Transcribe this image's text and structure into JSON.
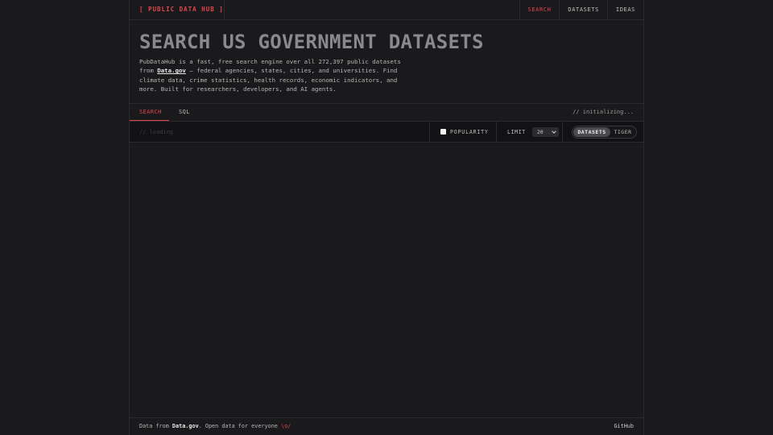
{
  "nav": {
    "brand": "[ PUBLIC DATA HUB ]",
    "links": [
      {
        "label": "SEARCH",
        "active": true
      },
      {
        "label": "DATASETS",
        "active": false
      },
      {
        "label": "IDEAS",
        "active": false
      }
    ]
  },
  "hero": {
    "title": "SEARCH US GOVERNMENT DATASETS",
    "desc_prefix": "PubDataHub is a fast, free search engine over all 272,397 public datasets from ",
    "desc_link": "Data.gov",
    "desc_suffix": " — federal agencies, states, cities, and universities. Find climate data, crime statistics, health records, economic indicators, and more. Built for researchers, developers, and AI agents."
  },
  "tabs": {
    "search": "SEARCH",
    "sql": "SQL",
    "status": "// initializing..."
  },
  "searchbar": {
    "placeholder": "// loading",
    "popularity_label": "POPULARITY",
    "popularity_checked": false,
    "limit_label": "LIMIT",
    "limit_value": "20",
    "toggle": {
      "datasets": "DATASETS",
      "tiger": "TIGER",
      "selected": "DATASETS"
    }
  },
  "footer": {
    "prefix": "Data from ",
    "link": "Data.gov",
    "middle": ". Open data for everyone ",
    "emoji": "\\o/",
    "github": "GitHub"
  },
  "colors": {
    "accent": "#e0474c",
    "background": "#1a1a1c",
    "bar_background": "#121214"
  }
}
